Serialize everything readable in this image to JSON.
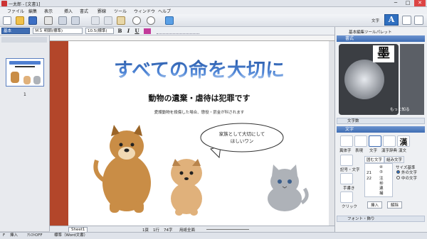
{
  "window": {
    "title": "一太郎 - [文書1]",
    "minimize": "─",
    "maximize": "□",
    "close": "✕"
  },
  "menu": [
    "ファイル",
    "編集",
    "表示",
    "挿入",
    "書式",
    "罫線",
    "ツール",
    "ウィンドウ",
    "ヘルプ"
  ],
  "toolbar": {
    "moji_label": "文字",
    "moji_button": "A",
    "icons": [
      "new-file-icon",
      "open-folder-icon",
      "save-icon",
      "print-icon",
      "undo-icon",
      "redo-icon",
      "cut-icon",
      "copy-icon",
      "paste-icon",
      "search-icon",
      "zoom-icon",
      "jump-icon"
    ]
  },
  "format_bar": {
    "style": "基本",
    "font": "ＭＳ 明朝(標準)",
    "size": "10.5(標準)",
    "bold": "B",
    "italic": "I",
    "underline": "U"
  },
  "left_pane": {
    "page_number": "1"
  },
  "document": {
    "headline": "すべての命を大切に",
    "subheading": "動物の遺棄・虐待は犯罪です",
    "notice": "愛護動物を殺傷した場合、懲役・罰金が科されます",
    "bubble_line1": "家族として大切にして",
    "bubble_line2": "ほしいワン"
  },
  "bottom_bar": {
    "sheet_tab": "Sheet1",
    "page_info": "1頁",
    "line_info": "1行",
    "percent": "74字",
    "zoom": "用紙全面"
  },
  "status_bar": {
    "mode1": "F",
    "mode2": "挿入",
    "mode3": "ｱｼｽﾄOFF",
    "style_name": "標準（Word文書）"
  },
  "right_panel": {
    "title": "基本編集ツールパレット",
    "section_shoen": "書式",
    "preview_char": "墨",
    "more_label": "もっと知る",
    "section_mojisuu": "文字数",
    "section_moji": "文字",
    "tool_labels": [
      "異体字",
      "表現",
      "文字",
      "漢字辞典",
      "漢文"
    ],
    "side_buttons": [
      "記号・文字",
      "手書き",
      "クリック"
    ],
    "tab1": "囲む文字",
    "tab2": "組み文字",
    "size_label": "サイズ基準",
    "radio1": "外の文字",
    "radio2": "中の文字",
    "list_numbers": [
      "21",
      "22"
    ],
    "list_chars": [
      "④",
      "⑤",
      "注",
      "㊙",
      "連",
      "捕"
    ],
    "insert_button": "挿入",
    "delete_button": "解除",
    "section_font": "フォント・飾り"
  }
}
